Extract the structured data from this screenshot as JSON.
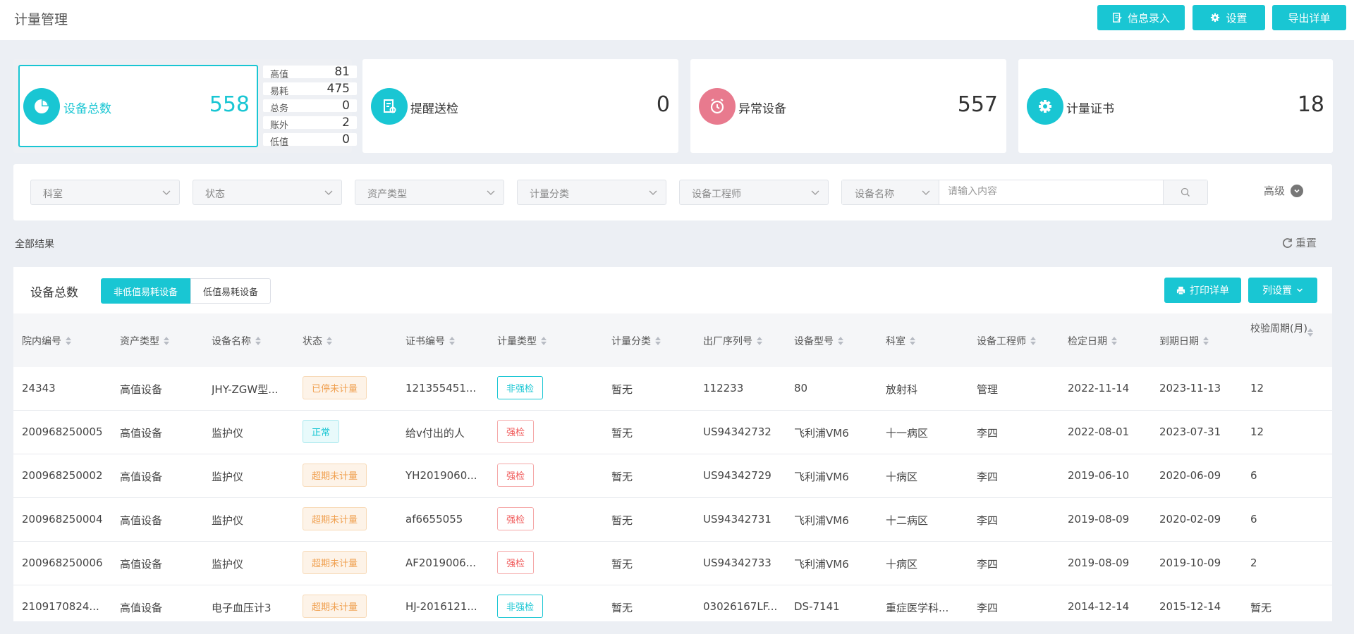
{
  "header": {
    "title": "计量管理",
    "buttons": {
      "info_entry": "信息录入",
      "settings": "设置",
      "export": "导出详单"
    }
  },
  "stats": {
    "total": {
      "label": "设备总数",
      "value": "558"
    },
    "sub": [
      {
        "key": "高值",
        "value": "81"
      },
      {
        "key": "易耗",
        "value": "475"
      },
      {
        "key": "总务",
        "value": "0"
      },
      {
        "key": "账外",
        "value": "2"
      },
      {
        "key": "低值",
        "value": "0"
      }
    ],
    "remind": {
      "label": "提醒送检",
      "value": "0"
    },
    "abnormal": {
      "label": "异常设备",
      "value": "557"
    },
    "cert": {
      "label": "计量证书",
      "value": "18"
    }
  },
  "filters": {
    "dept": "科室",
    "status": "状态",
    "asset_type": "资产类型",
    "measure_class": "计量分类",
    "engineer": "设备工程师",
    "search_field": "设备名称",
    "search_placeholder": "请输入内容",
    "advanced": "高级"
  },
  "results_label": "全部结果",
  "reset_label": "重置",
  "table_panel": {
    "title": "设备总数",
    "tabs": [
      "非低值易耗设备",
      "低值易耗设备"
    ],
    "print": "打印详单",
    "columns_btn": "列设置"
  },
  "columns": [
    "院内编号",
    "资产类型",
    "设备名称",
    "状态",
    "证书编号",
    "计量类型",
    "计量分类",
    "出厂序列号",
    "设备型号",
    "科室",
    "设备工程师",
    "检定日期",
    "到期日期",
    "校验周期(月)"
  ],
  "rows": [
    {
      "id": "24343",
      "asset": "高值设备",
      "name": "JHY-ZGW型...",
      "status": "已停未计量",
      "cert": "121355451...",
      "mtype": "非强检",
      "mclass": "暂无",
      "serial": "112233",
      "model": "80",
      "dept": "放射科",
      "eng": "管理",
      "check": "2022-11-14",
      "due": "2023-11-13",
      "cycle": "12"
    },
    {
      "id": "200968250005",
      "asset": "高值设备",
      "name": "监护仪",
      "status": "正常",
      "cert": "给v付出的人",
      "mtype": "强检",
      "mclass": "暂无",
      "serial": "US94342732",
      "model": "飞利浦VM6",
      "dept": "十一病区",
      "eng": "李四",
      "check": "2022-08-01",
      "due": "2023-07-31",
      "cycle": "12"
    },
    {
      "id": "200968250002",
      "asset": "高值设备",
      "name": "监护仪",
      "status": "超期未计量",
      "cert": "YH2019060...",
      "mtype": "强检",
      "mclass": "暂无",
      "serial": "US94342729",
      "model": "飞利浦VM6",
      "dept": "十病区",
      "eng": "李四",
      "check": "2019-06-10",
      "due": "2020-06-09",
      "cycle": "6"
    },
    {
      "id": "200968250004",
      "asset": "高值设备",
      "name": "监护仪",
      "status": "超期未计量",
      "cert": "af6655055",
      "mtype": "强检",
      "mclass": "暂无",
      "serial": "US94342731",
      "model": "飞利浦VM6",
      "dept": "十二病区",
      "eng": "李四",
      "check": "2019-08-09",
      "due": "2020-02-09",
      "cycle": "6"
    },
    {
      "id": "200968250006",
      "asset": "高值设备",
      "name": "监护仪",
      "status": "超期未计量",
      "cert": "AF2019006...",
      "mtype": "强检",
      "mclass": "暂无",
      "serial": "US94342733",
      "model": "飞利浦VM6",
      "dept": "十病区",
      "eng": "李四",
      "check": "2019-08-09",
      "due": "2019-10-09",
      "cycle": "2"
    },
    {
      "id": "2109170824...",
      "asset": "高值设备",
      "name": "电子血压计3",
      "status": "超期未计量",
      "cert": "HJ-2016121...",
      "mtype": "非强检",
      "mclass": "暂无",
      "serial": "03026167LF...",
      "model": "DS-7141",
      "dept": "重症医学科...",
      "eng": "李四",
      "check": "2014-12-14",
      "due": "2015-12-14",
      "cycle": "暂无"
    }
  ],
  "colors": {
    "accent": "#19c6d3",
    "abnormal": "#e87a8e",
    "orange": "#f0a050",
    "red": "#f05a5a"
  }
}
